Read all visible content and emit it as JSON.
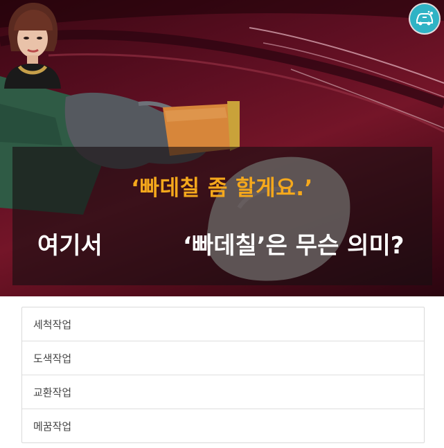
{
  "hero": {
    "quote": "‘빠데칠 좀 할게요.’",
    "question_left": "여기서",
    "question_right": "‘빠데칠’은 무슨 의미?",
    "badge_icon": "car-wash-icon",
    "accent_color": "#f5a81c",
    "badge_color": "#2fb3c5"
  },
  "options": [
    {
      "label": "세척작업"
    },
    {
      "label": "도색작업"
    },
    {
      "label": "교환작업"
    },
    {
      "label": "메꿈작업"
    }
  ]
}
